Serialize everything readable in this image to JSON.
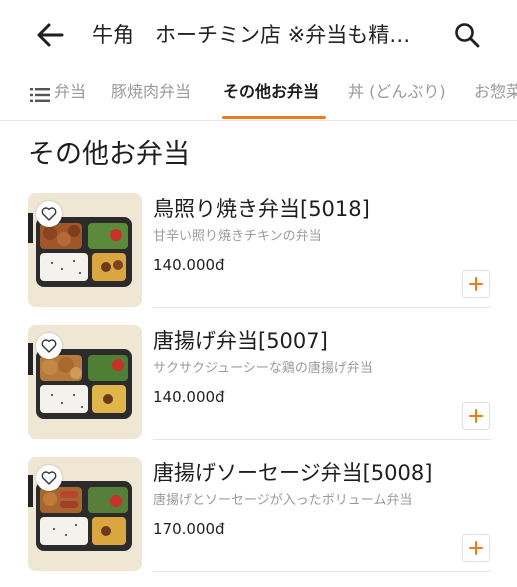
{
  "header": {
    "title": "牛角　ホーチミン店 ※弁当も精…"
  },
  "tabs": [
    {
      "label": "弁当"
    },
    {
      "label": "豚焼肉弁当"
    },
    {
      "label": "その他お弁当"
    },
    {
      "label": "丼 (どんぶり)"
    },
    {
      "label": "お惣菜"
    }
  ],
  "section": {
    "title": "その他お弁当"
  },
  "items": [
    {
      "name": "鳥照り焼き弁当[5018]",
      "description": "甘辛い照り焼きチキンの弁当",
      "price": "140.000đ"
    },
    {
      "name": "唐揚げ弁当[5007]",
      "description": "サクサクジューシーな鶏の唐揚げ弁当",
      "price": "140.000đ"
    },
    {
      "name": "唐揚げソーセージ弁当[5008]",
      "description": "唐揚げとソーセージが入ったボリューム弁当",
      "price": "170.000đ"
    }
  ],
  "icons": {
    "back": "arrow-left-icon",
    "search": "search-icon",
    "menu": "list-menu-icon",
    "favorite": "heart-icon",
    "add": "plus-icon"
  },
  "colors": {
    "accent": "#f27a1a"
  }
}
